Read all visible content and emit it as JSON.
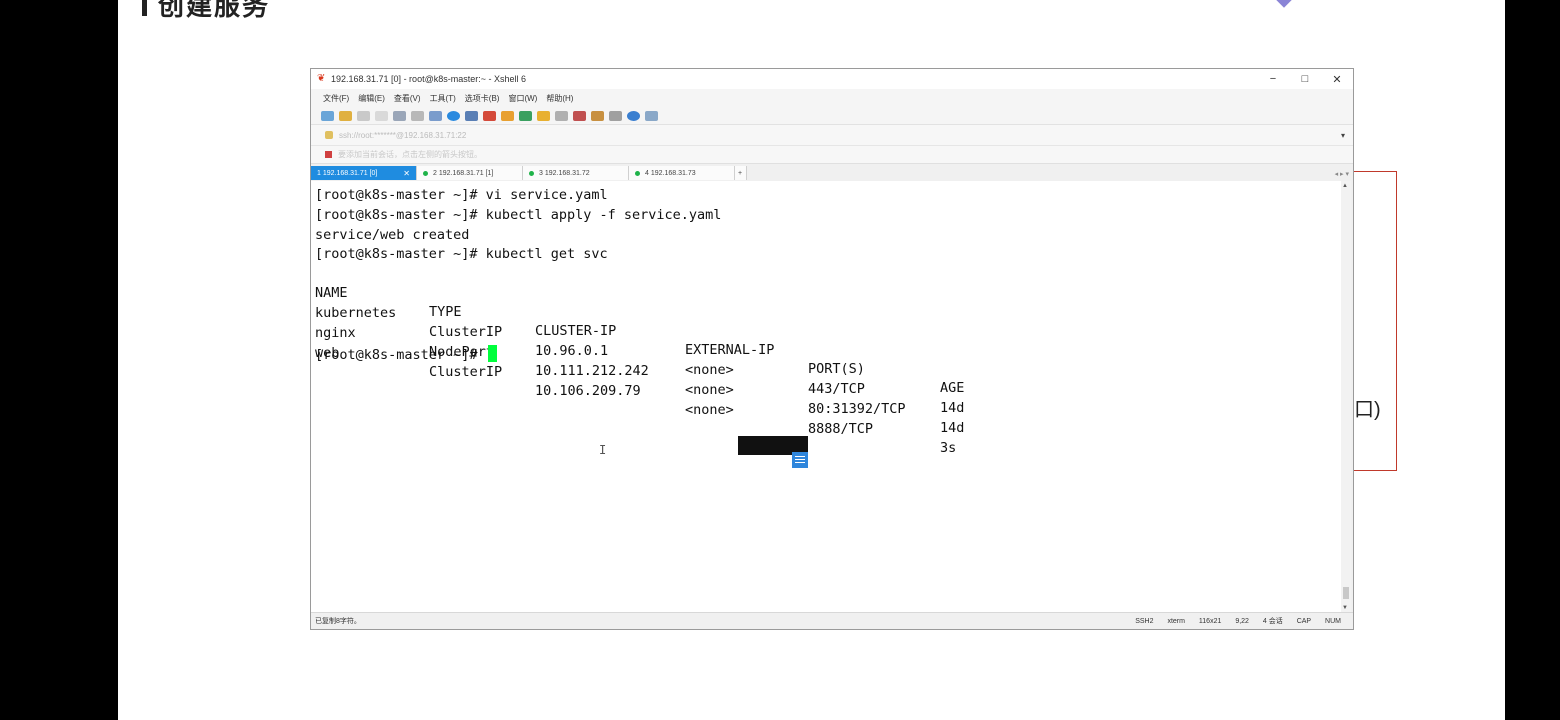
{
  "slide": {
    "heading": "创建服务"
  },
  "side_text": "口)",
  "window": {
    "title": "192.168.31.71 [0] - root@k8s-master:~ - Xshell 6",
    "controls": {
      "minimize": "−",
      "maximize": "□",
      "close": "✕"
    },
    "menu": [
      "文件(F)",
      "编辑(E)",
      "查看(V)",
      "工具(T)",
      "选项卡(B)",
      "窗口(W)",
      "帮助(H)"
    ],
    "toolbar_icons": [
      "new-session-icon",
      "open-folder-icon",
      "reconnect-icon",
      "copy-icon",
      "paste-icon",
      "find-icon",
      "properties-icon",
      "globe-icon",
      "font-icon",
      "xftp-icon",
      "compose-icon",
      "fullscreen-icon",
      "lock-icon",
      "transfer-icon",
      "script-icon",
      "tabs-icon",
      "layout-icon",
      "help-icon",
      "chat-icon"
    ],
    "address": "ssh://root:*******@192.168.31.71:22",
    "address_hint": "要添加当前会话，点击左侧的箭头按钮。",
    "tabs": [
      {
        "label": "1 192.168.31.71 [0]",
        "active": true
      },
      {
        "label": "2 192.168.31.71 [1]",
        "active": false
      },
      {
        "label": "3 192.168.31.72",
        "active": false
      },
      {
        "label": "4 192.168.31.73",
        "active": false
      }
    ],
    "add_tab": "+",
    "status": {
      "left": "已复制8字符。",
      "protocol": "SSH2",
      "term": "xterm",
      "size": "116x21",
      "pos": "9,22",
      "sessions": "4 会话",
      "caps": "CAP",
      "num": "NUM"
    }
  },
  "terminal": {
    "lines": [
      "[root@k8s-master ~]# vi service.yaml",
      "[root@k8s-master ~]# kubectl apply -f service.yaml",
      "service/web created",
      "[root@k8s-master ~]# kubectl get svc"
    ],
    "svc_table": {
      "headers": [
        "NAME",
        "TYPE",
        "CLUSTER-IP",
        "EXTERNAL-IP",
        "PORT(S)",
        "AGE"
      ],
      "rows": [
        [
          "kubernetes",
          "ClusterIP",
          "10.96.0.1",
          "<none>",
          "443/TCP",
          "14d"
        ],
        [
          "nginx",
          "NodePort",
          "10.111.212.242",
          "<none>",
          "80:31392/TCP",
          "14d"
        ],
        [
          "web",
          "ClusterIP",
          "10.106.209.79",
          "<none>",
          "8888/TCP",
          "3s"
        ]
      ]
    },
    "prompt": "[root@k8s-master ~]# "
  },
  "colors": {
    "tab_active": "#1f8ce0",
    "cursor": "#00ff3c",
    "frame": "#c0392b"
  }
}
